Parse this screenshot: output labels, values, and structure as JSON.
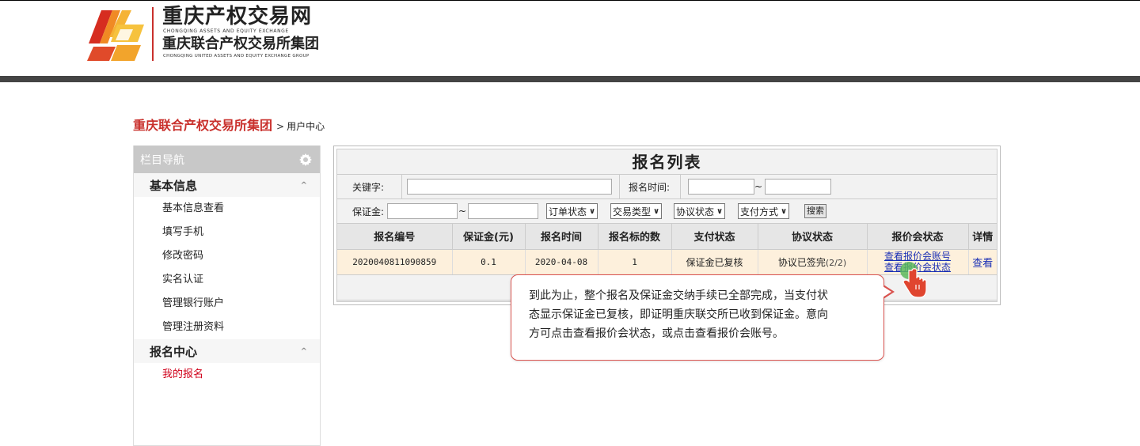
{
  "header": {
    "title": "重庆产权交易网",
    "subtitle_en": "CHONGQING ASSETS AND EQUITY EXCHANGE",
    "title2": "重庆联合产权交易所集团",
    "subtitle2_en": "CHONGQING UNITED ASSETS AND EQUITY EXCHANGE GROUP"
  },
  "breadcrumb": {
    "root": "重庆联合产权交易所集团",
    "separator": ">",
    "current": "用户中心"
  },
  "sidebar": {
    "title": "栏目导航",
    "sections": [
      {
        "label": "基本信息",
        "items": [
          "基本信息查看",
          "填写手机",
          "修改密码",
          "实名认证",
          "管理银行账户",
          "管理注册资料"
        ]
      },
      {
        "label": "报名中心",
        "items": [
          "我的报名"
        ]
      }
    ],
    "active_item": "我的报名",
    "caret": "^"
  },
  "panel": {
    "title": "报名列表",
    "filters": {
      "keyword_label": "关键字:",
      "keyword_value": "",
      "time_label": "报名时间:",
      "time_from": "",
      "time_to": "",
      "range_sep": "~",
      "deposit_label": "保证金:",
      "deposit_from": "",
      "deposit_to": "",
      "selects": [
        "订单状态",
        "交易类型",
        "协议状态",
        "支付方式"
      ],
      "search_button": "搜索"
    },
    "table": {
      "columns": [
        "报名编号",
        "保证金(元)",
        "报名时间",
        "报名标的数",
        "支付状态",
        "协议状态",
        "报价会状态",
        "详情"
      ],
      "rows": [
        {
          "id": "2020040811090859",
          "deposit": "0.1",
          "date": "2020-04-08",
          "count": "1",
          "pay_status": "保证金已复核",
          "agreement_status": "协议已签完",
          "agreement_progress": "(2/2)",
          "quote_account_link": "查看报价会账号",
          "quote_status_link": "查看报价会状态",
          "detail_link": "查看"
        }
      ]
    }
  },
  "tooltip": {
    "line1": "到此为止，整个报名及保证金交纳手续已全部完成，当支付状",
    "line2": "态显示保证金已复核，即证明重庆联交所已收到保证金。意向",
    "line3": "方可点击查看报价会状态，或点击查看报价会账号。"
  },
  "colors": {
    "brand_red": "#c9302c",
    "active_red": "#d0021b",
    "link_blue": "#1a2fb5",
    "header_bar": "#444444",
    "row_highlight": "#fdf0dc",
    "pointer_red": "#e0452f",
    "pointer_green": "#5cb85c"
  },
  "icons": {
    "gear": "gear-icon",
    "pointer": "hand-pointer-icon",
    "logo": "logo-icon"
  }
}
